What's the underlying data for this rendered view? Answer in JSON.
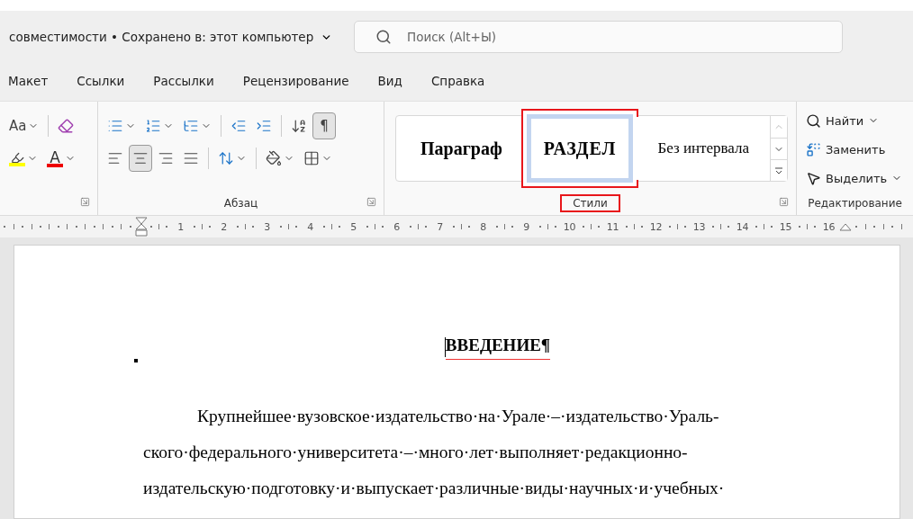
{
  "title_bar": {
    "title": "совместимости • Сохранено в: этот компьютер",
    "search": {
      "placeholder": "Поиск (Alt+Ы)"
    }
  },
  "tabs": [
    {
      "label": "Макет",
      "selected": false
    },
    {
      "label": "Ссылки",
      "selected": false
    },
    {
      "label": "Рассылки",
      "selected": false
    },
    {
      "label": "Рецензирование",
      "selected": false
    },
    {
      "label": "Вид",
      "selected": false
    },
    {
      "label": "Справка",
      "selected": false
    }
  ],
  "font_group": {
    "case_button": {
      "label": "Аа"
    },
    "highlight": {
      "color": "#ffff00"
    },
    "font_color": {
      "label": "A",
      "color": "#ee0000"
    }
  },
  "paragraph_group": {
    "label": "Абзац",
    "row_1": [
      {
        "selected": false
      },
      {
        "selected": false
      },
      {
        "selected": false
      },
      {
        "selected": false
      },
      {
        "selected": false
      },
      {
        "selected": false
      },
      {
        "label": "¶",
        "selected": true
      }
    ],
    "row_2": [
      {
        "selected": false
      },
      {
        "selected": true
      },
      {
        "selected": false
      },
      {
        "selected": false
      },
      {
        "selected": false
      },
      {
        "selected": false
      },
      {
        "selected": false
      }
    ]
  },
  "styles_group": {
    "label": "Стили",
    "annotated": true,
    "items": [
      {
        "label": "Параграф",
        "kind": "heading",
        "selected": false,
        "annotated": false
      },
      {
        "label": "РАЗДЕЛ",
        "kind": "section",
        "selected": true,
        "annotated": true
      },
      {
        "label": "Без интервала",
        "kind": "plain",
        "selected": false,
        "annotated": false
      }
    ]
  },
  "editing_group": {
    "label": "Редактирование",
    "items": [
      {
        "label": "Найти",
        "dropdown": true
      },
      {
        "label": "Заменить",
        "dropdown": false
      },
      {
        "label": "Выделить",
        "dropdown": true
      }
    ]
  },
  "ruler": {
    "numbers": [
      "1",
      "2",
      "3",
      "4",
      "5",
      "6",
      "7",
      "8",
      "9",
      "10",
      "11",
      "12",
      "13",
      "14",
      "15",
      "16"
    ]
  },
  "document": {
    "heading": {
      "text": "ВВЕДЕНИЕ¶",
      "spelling_error": true
    },
    "lines": [
      "Крупнейшее·вузовское·издательство·на·Урале·–·издательство·Ураль-",
      "ского·федерального·университета·–·много·лет·выполняет·редакционно-",
      "издательскую·подготовку·и·выпускает·различные·виды·научных·и·учебных·"
    ]
  }
}
